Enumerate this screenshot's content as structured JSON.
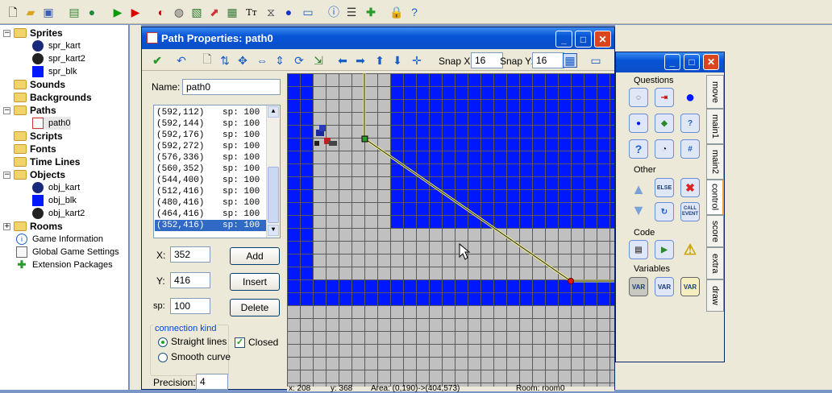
{
  "tree": {
    "items": [
      {
        "label": "Sprites",
        "kind": "folder",
        "bold": true
      },
      {
        "label": "spr_kart",
        "kind": "sprite-kart"
      },
      {
        "label": "spr_kart2",
        "kind": "sprite-kart"
      },
      {
        "label": "spr_blk",
        "kind": "sprite-blk"
      },
      {
        "label": "Sounds",
        "kind": "folder",
        "bold": true
      },
      {
        "label": "Backgrounds",
        "kind": "folder",
        "bold": true
      },
      {
        "label": "Paths",
        "kind": "folder",
        "bold": true
      },
      {
        "label": "path0",
        "kind": "path"
      },
      {
        "label": "Scripts",
        "kind": "folder",
        "bold": true
      },
      {
        "label": "Fonts",
        "kind": "folder",
        "bold": true
      },
      {
        "label": "Time Lines",
        "kind": "folder",
        "bold": true
      },
      {
        "label": "Objects",
        "kind": "folder",
        "bold": true
      },
      {
        "label": "obj_kart",
        "kind": "sprite-kart"
      },
      {
        "label": "obj_blk",
        "kind": "sprite-blk"
      },
      {
        "label": "obj_kart2",
        "kind": "sprite-kart"
      },
      {
        "label": "Rooms",
        "kind": "folder",
        "bold": true
      },
      {
        "label": "Game Information",
        "kind": "info"
      },
      {
        "label": "Global Game Settings",
        "kind": "settings"
      },
      {
        "label": "Extension Packages",
        "kind": "ext"
      }
    ]
  },
  "window": {
    "title": "Path Properties: path0",
    "snap_x_label": "Snap X:",
    "snap_x": "16",
    "snap_y_label": "Snap Y:",
    "snap_y": "16"
  },
  "form": {
    "name_label": "Name:",
    "name_value": "path0",
    "points": [
      {
        "xy": "(592,112)",
        "sp": "sp: 100"
      },
      {
        "xy": "(592,144)",
        "sp": "sp: 100"
      },
      {
        "xy": "(592,176)",
        "sp": "sp: 100"
      },
      {
        "xy": "(592,272)",
        "sp": "sp: 100"
      },
      {
        "xy": "(576,336)",
        "sp": "sp: 100"
      },
      {
        "xy": "(560,352)",
        "sp": "sp: 100"
      },
      {
        "xy": "(544,400)",
        "sp": "sp: 100"
      },
      {
        "xy": "(512,416)",
        "sp": "sp: 100"
      },
      {
        "xy": "(480,416)",
        "sp": "sp: 100"
      },
      {
        "xy": "(464,416)",
        "sp": "sp: 100"
      },
      {
        "xy": "(352,416)",
        "sp": "sp: 100"
      }
    ],
    "x_label": "X:",
    "x_value": "352",
    "y_label": "Y:",
    "y_value": "416",
    "sp_label": "sp:",
    "sp_value": "100",
    "add_label": "Add",
    "insert_label": "Insert",
    "delete_label": "Delete",
    "connection_kind_label": "connection kind",
    "straight_label": "Straight lines",
    "smooth_label": "Smooth curve",
    "closed_label": "Closed",
    "precision_label": "Precision:",
    "precision_value": "4"
  },
  "status": {
    "x": "x: 208",
    "y": "y: 368",
    "area": "Area: (0,190)->(404,573)",
    "room": "Room: room0"
  },
  "actions": {
    "questions_label": "Questions",
    "other_label": "Other",
    "code_label": "Code",
    "variables_label": "Variables",
    "else_label": "ELSE",
    "call_label": "CALL EVENT",
    "var_label": "VAR",
    "tabs": [
      "move",
      "main1",
      "main2",
      "control",
      "score",
      "extra",
      "draw"
    ]
  },
  "colors": {
    "wall_blue": "#0018ff",
    "grid_gray": "#c0c0c0",
    "title_blue": "#0a4ec8"
  }
}
